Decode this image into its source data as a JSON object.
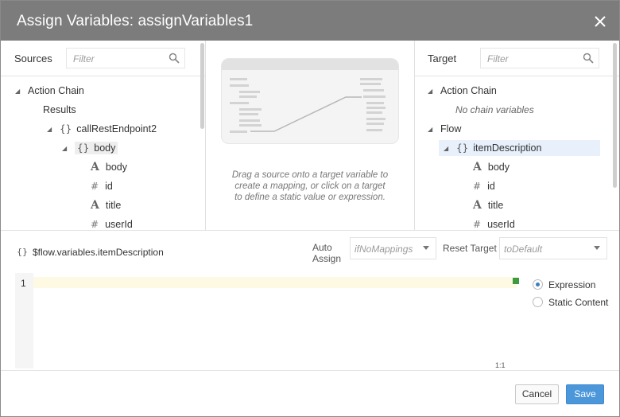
{
  "dialog": {
    "title": "Assign Variables: assignVariables1",
    "close_icon": "close-icon"
  },
  "sources": {
    "label": "Sources",
    "filter_placeholder": "Filter",
    "tree": {
      "root": "Action Chain",
      "results": "Results",
      "endpoint": "callRestEndpoint2",
      "body": "body",
      "fields": [
        {
          "type": "string",
          "name": "body"
        },
        {
          "type": "number",
          "name": "id"
        },
        {
          "type": "string",
          "name": "title"
        },
        {
          "type": "number",
          "name": "userId"
        }
      ]
    }
  },
  "middle": {
    "hint": "Drag a source onto a target variable to create a mapping, or click on a target to define a static value or expression."
  },
  "target": {
    "label": "Target",
    "filter_placeholder": "Filter",
    "tree": {
      "action_chain": "Action Chain",
      "no_vars": "No chain variables",
      "flow": "Flow",
      "item": "itemDescription",
      "fields": [
        {
          "type": "string",
          "name": "body"
        },
        {
          "type": "number",
          "name": "id"
        },
        {
          "type": "string",
          "name": "title"
        },
        {
          "type": "number",
          "name": "userId"
        }
      ]
    }
  },
  "mapping": {
    "path": "$flow.variables.itemDescription",
    "auto_assign_label_1": "Auto",
    "auto_assign_label_2": "Assign",
    "auto_assign_value": "ifNoMappings",
    "reset_target_label": "Reset Target",
    "reset_target_value": "toDefault"
  },
  "editor": {
    "line_number": "1",
    "cursor_position": "1:1",
    "mode_options": [
      {
        "label": "Expression",
        "selected": true
      },
      {
        "label": "Static Content",
        "selected": false
      }
    ]
  },
  "footer": {
    "cancel_label": "Cancel",
    "save_label": "Save"
  },
  "colors": {
    "title_bar": "#7c7c7c",
    "accent": "#4b97d9",
    "selection": "#e7f0fb",
    "cursor": "#3e9a3e"
  }
}
